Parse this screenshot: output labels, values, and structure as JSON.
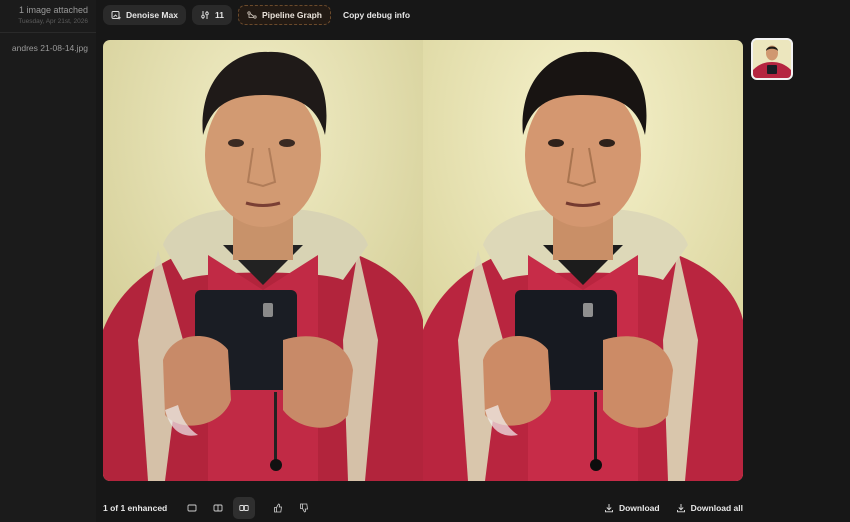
{
  "sidebar": {
    "title": "1 image attached",
    "date": "Tuesday, Apr 21st, 2026",
    "file_name": "andres 21-08-14.jpg"
  },
  "toolbar": {
    "denoise_label": "Denoise Max",
    "denoise_icon": "image-sparkle-icon",
    "settings_count": "11",
    "settings_icon": "sliders-icon",
    "pipeline_label": "Pipeline Graph",
    "pipeline_icon": "graph-icon",
    "debug_label": "Copy debug info"
  },
  "footer": {
    "count_label": "1 of 1 enhanced",
    "view_modes": [
      "single-view-icon",
      "split-view-icon",
      "side-by-side-icon"
    ],
    "active_view": "side-by-side-icon",
    "download_label": "Download",
    "download_all_label": "Download all"
  },
  "colors": {
    "background": "#171717",
    "sidebar": "#1b1b1b",
    "button": "#2a2a2a",
    "accent_border": "#6b4a2b"
  }
}
